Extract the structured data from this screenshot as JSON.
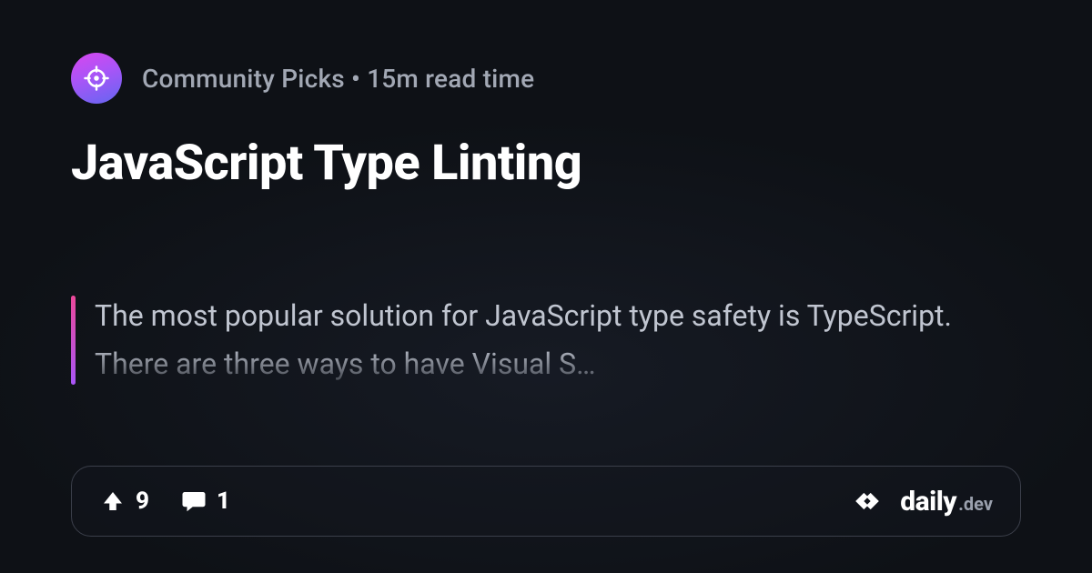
{
  "meta": {
    "source": "Community Picks",
    "separator": " • ",
    "readtime": "15m read time"
  },
  "title": "JavaScript Type Linting",
  "excerpt": "The most popular solution for JavaScript type safety is TypeScript. There are three ways to have Visual S…",
  "stats": {
    "upvotes": "9",
    "comments": "1"
  },
  "brand": {
    "name": "daily",
    "tld": ".dev"
  }
}
